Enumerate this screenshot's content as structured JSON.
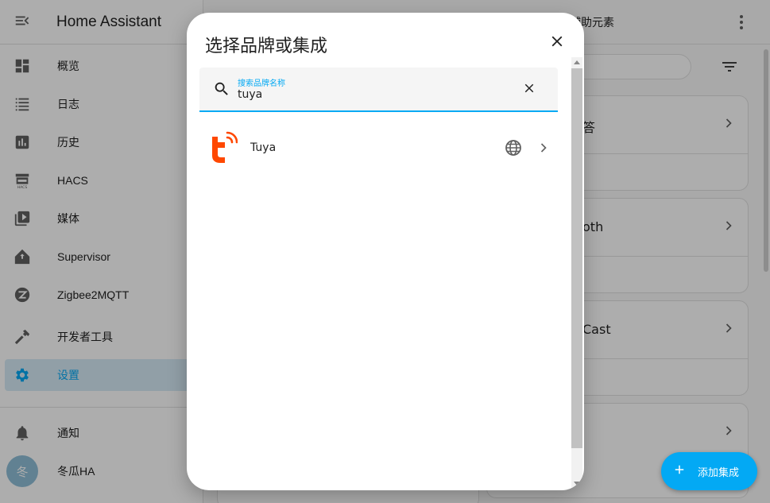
{
  "app": {
    "title": "Home Assistant",
    "menu_icon": "menu-open-icon"
  },
  "sidebar": {
    "items": [
      {
        "label": "概览",
        "icon": "dashboard-icon"
      },
      {
        "label": "日志",
        "icon": "logbook-icon"
      },
      {
        "label": "历史",
        "icon": "history-chart-icon"
      },
      {
        "label": "HACS",
        "icon": "hacs-store-icon"
      },
      {
        "label": "媒体",
        "icon": "media-play-icon"
      },
      {
        "label": "Supervisor",
        "icon": "supervisor-icon"
      },
      {
        "label": "Zigbee2MQTT",
        "icon": "zigbee-icon"
      },
      {
        "label": "开发者工具",
        "icon": "hammer-icon"
      },
      {
        "label": "设置",
        "icon": "gear-icon"
      }
    ],
    "notifications_label": "通知",
    "user": {
      "label": "冬瓜HA",
      "initial": "冬"
    }
  },
  "header": {
    "tab_partial": "辅助元素"
  },
  "background_cards": [
    {
      "text": "答"
    },
    {
      "text": "oth"
    },
    {
      "text": "Cast"
    },
    {
      "text": ""
    }
  ],
  "fab": {
    "label": "添加集成",
    "icon": "plus-icon"
  },
  "dialog": {
    "title": "选择品牌或集成",
    "search": {
      "label": "搜索品牌名称",
      "value": "tuya"
    },
    "results": [
      {
        "name": "Tuya",
        "logo": "tuya-logo",
        "badge_icon": "globe-icon"
      }
    ]
  },
  "colors": {
    "accent": "#03a9f4",
    "tuya_orange": "#ff4800"
  }
}
